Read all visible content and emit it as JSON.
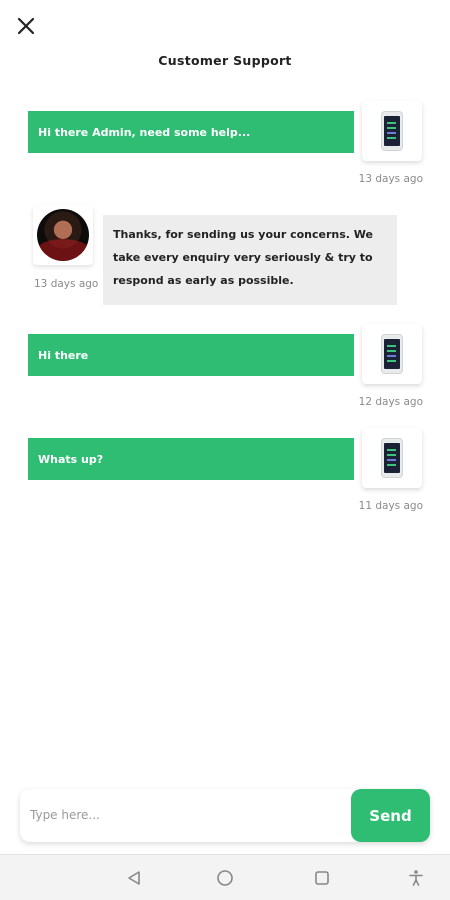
{
  "header": {
    "title": "Customer Support"
  },
  "messages": [
    {
      "text": "Hi there Admin, need some help...",
      "time": "13 days ago"
    },
    {
      "text": "Thanks, for sending us your concerns. We take every enquiry very seriously & try to respond as early as possible.",
      "time": "13 days ago"
    },
    {
      "text": "Hi there",
      "time": "12 days ago"
    },
    {
      "text": "Whats up?",
      "time": "11 days ago"
    }
  ],
  "composer": {
    "placeholder": "Type here...",
    "send_label": "Send"
  },
  "icons": {
    "close": "close-icon",
    "attachment": "phone-image-icon",
    "avatar": "avatar",
    "nav_back": "back-icon",
    "nav_home": "home-icon",
    "nav_recents": "recents-icon",
    "nav_accessibility": "accessibility-icon"
  },
  "colors": {
    "accent": "#2ebd73",
    "admin_bubble": "#ededed",
    "timestamp": "#8a8a8a"
  }
}
